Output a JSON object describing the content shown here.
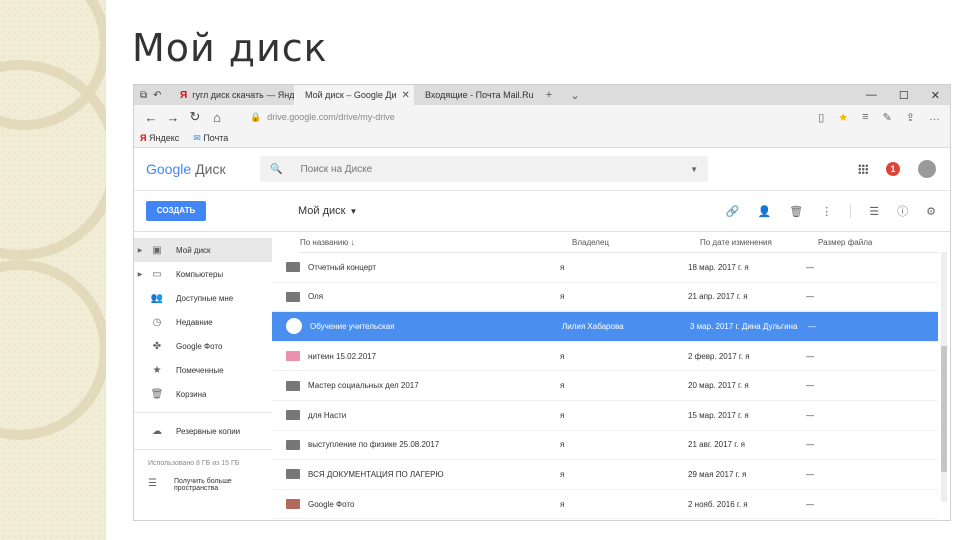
{
  "slide": {
    "title": "Мой диск"
  },
  "browser": {
    "tabs": [
      {
        "label": "гугл диск скачать — Яндек"
      },
      {
        "label": "Мой диск – Google Ди"
      },
      {
        "label": "Входящие - Почта Mail.Ru"
      }
    ],
    "url": "drive.google.com/drive/my-drive",
    "favorites": [
      "Яндекс",
      "Почта"
    ]
  },
  "drive": {
    "logo": {
      "google": "Google",
      "product": "Диск"
    },
    "search_placeholder": "Поиск на Диске",
    "notification_count": "1",
    "create_label": "СОЗДАТЬ",
    "breadcrumb": "Мой диск",
    "sidebar": {
      "items": [
        {
          "label": "Мой диск"
        },
        {
          "label": "Компьютеры"
        },
        {
          "label": "Доступные мне"
        },
        {
          "label": "Недавние"
        },
        {
          "label": "Google Фото"
        },
        {
          "label": "Помеченные"
        },
        {
          "label": "Корзина"
        },
        {
          "label": "Резервные копии"
        }
      ],
      "quota": "Использовано 8 ГБ из 15 ГБ",
      "upgrade_line1": "Получить больше",
      "upgrade_line2": "пространства"
    },
    "columns": {
      "name": "По названию",
      "owner": "Владелец",
      "date": "По дате изменения",
      "size": "Размер файла"
    },
    "files": [
      {
        "name": "Отчетный концерт",
        "owner": "я",
        "date": "18 мар. 2017 г. я",
        "size": "—",
        "color": "#777777"
      },
      {
        "name": "Оля",
        "owner": "я",
        "date": "21 апр. 2017 г. я",
        "size": "—",
        "color": "#777777"
      },
      {
        "name": "Обучение учительская",
        "owner": "Лилия Хабарова",
        "date": "3 мар. 2017 г. Дина Дульгина",
        "size": "—",
        "color": "#ffffff"
      },
      {
        "name": "нитеин 15.02.2017",
        "owner": "я",
        "date": "2 февр. 2017 г. я",
        "size": "—",
        "color": "#e991ad"
      },
      {
        "name": "Мастер социальных дел 2017",
        "owner": "я",
        "date": "20 мар. 2017 г. я",
        "size": "—",
        "color": "#777777"
      },
      {
        "name": "для Насти",
        "owner": "я",
        "date": "15 мар. 2017 г. я",
        "size": "—",
        "color": "#777777"
      },
      {
        "name": "выступление по физике 25.08.2017",
        "owner": "я",
        "date": "21 авг. 2017 г. я",
        "size": "—",
        "color": "#777777"
      },
      {
        "name": "ВСЯ ДОКУМЕНТАЦИЯ ПО ЛАГЕРЮ",
        "owner": "я",
        "date": "29 мая 2017 г. я",
        "size": "—",
        "color": "#777777"
      },
      {
        "name": "Google Фото",
        "owner": "я",
        "date": "2 нояб. 2016 г. я",
        "size": "—",
        "color": "#b0695a"
      }
    ],
    "colors": {
      "accent": "#4285f4",
      "selected_row": "#4a8ef0",
      "alert": "#db4437"
    }
  }
}
